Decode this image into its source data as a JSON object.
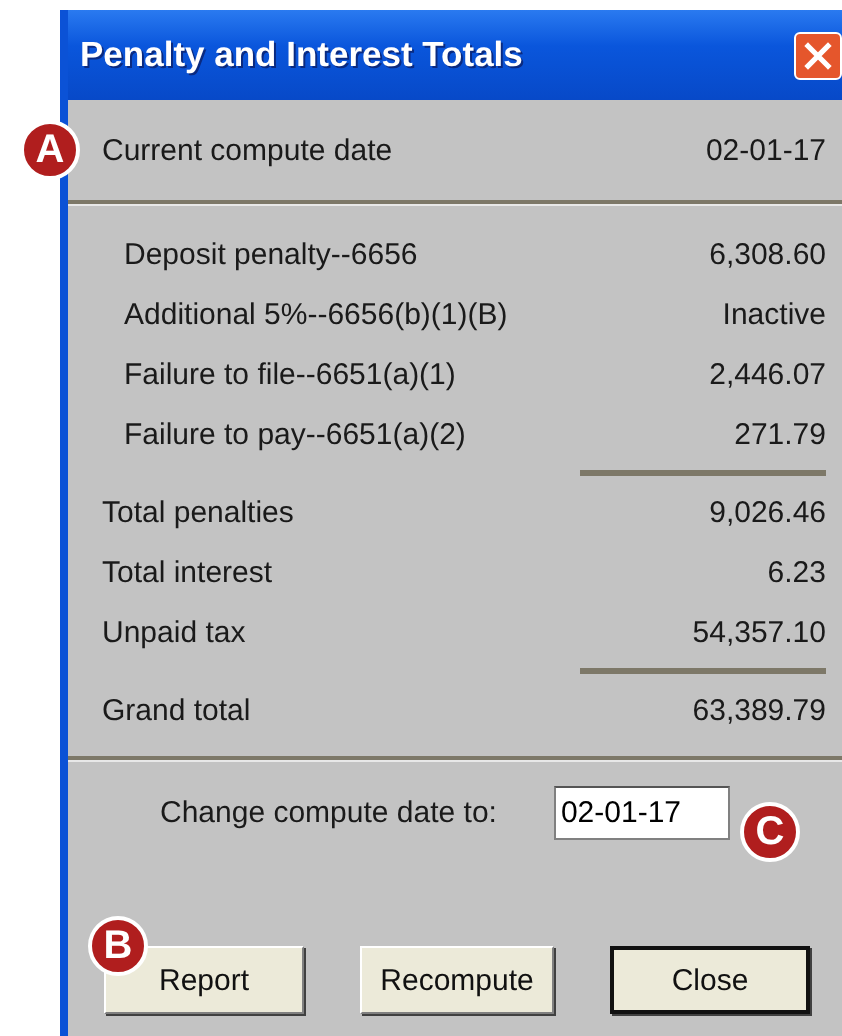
{
  "window": {
    "title": "Penalty and Interest Totals"
  },
  "current_date": {
    "label": "Current compute date",
    "value": "02-01-17",
    "callout": "A"
  },
  "lines": [
    {
      "kind": "detail",
      "label": "Deposit penalty--6656",
      "value": "6,308.60",
      "ruled": false
    },
    {
      "kind": "detail",
      "label": "Additional 5%--6656(b)(1)(B)",
      "value": "Inactive",
      "ruled": false
    },
    {
      "kind": "detail",
      "label": "Failure to file--6651(a)(1)",
      "value": "2,446.07",
      "ruled": false
    },
    {
      "kind": "detail",
      "label": "Failure to pay--6651(a)(2)",
      "value": "271.79",
      "ruled": true
    },
    {
      "kind": "total",
      "label": "Total penalties",
      "value": "9,026.46",
      "ruled": false
    },
    {
      "kind": "total",
      "label": "Total interest",
      "value": "6.23",
      "ruled": false
    },
    {
      "kind": "total",
      "label": "Unpaid tax",
      "value": "54,357.10",
      "ruled": true
    },
    {
      "kind": "total",
      "label": "Grand total",
      "value": "63,389.79",
      "ruled": false
    }
  ],
  "change_date": {
    "label": "Change compute date to:",
    "value": "02-01-17",
    "callout": "C"
  },
  "buttons": [
    {
      "label": "Report",
      "default": false,
      "callout": "B"
    },
    {
      "label": "Recompute",
      "default": false
    },
    {
      "label": "Close",
      "default": true
    }
  ]
}
